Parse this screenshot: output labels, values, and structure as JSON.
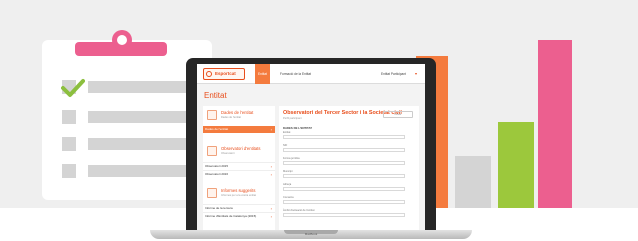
{
  "app": {
    "logo_text": "Esportcat",
    "nav": {
      "active_tab": "Entitat",
      "second_tab": "Formació de la Entitat"
    },
    "user_label": "Entitat Participant",
    "page_title": "Entitat"
  },
  "sidebar": {
    "cards": [
      {
        "title": "Dades de l'entitat",
        "subtitle": "Dades de l'entitat",
        "items": [
          {
            "label": "Dades de l'entitat",
            "active": true
          }
        ]
      },
      {
        "title": "Observatori d'entitats",
        "subtitle": "Observatori",
        "items": [
          {
            "label": "Observatori 2015",
            "active": false
          },
          {
            "label": "Observatori 2016",
            "active": false
          }
        ]
      },
      {
        "title": "Informes suggerits",
        "subtitle": "Informes per a la vostra entitat",
        "items": [
          {
            "label": "Informe de la tercera",
            "active": false
          },
          {
            "label": "Informe d'Entitats de Catalunya (2015)",
            "active": false
          }
        ]
      }
    ]
  },
  "content": {
    "title": "Observatori del Tercer Sector i la Societat civil",
    "subtitle": "Perfil participant",
    "button_label": "Desar",
    "section_label": "DADES DE L'ENTITAT",
    "fields": [
      {
        "label": "Entitat"
      },
      {
        "label": "NIF"
      },
      {
        "label": "Forma jurídica"
      },
      {
        "label": "Municipi"
      },
      {
        "label": "Adreça"
      },
      {
        "label": "Comarca"
      },
      {
        "label": "Àmbit d'actuació de l'entitat"
      }
    ]
  },
  "laptop": {
    "base_label": "MacBook"
  },
  "colors": {
    "brand_orange": "#f47b3e",
    "brand_red": "#e84e1c",
    "accent_pink": "#ec5f8f",
    "accent_green": "#9cc83c",
    "neutral_grey": "#d4d4d4"
  },
  "icons": {
    "check": "check-icon",
    "clip": "clipboard-icon",
    "chevron": "chevron-right-icon"
  }
}
